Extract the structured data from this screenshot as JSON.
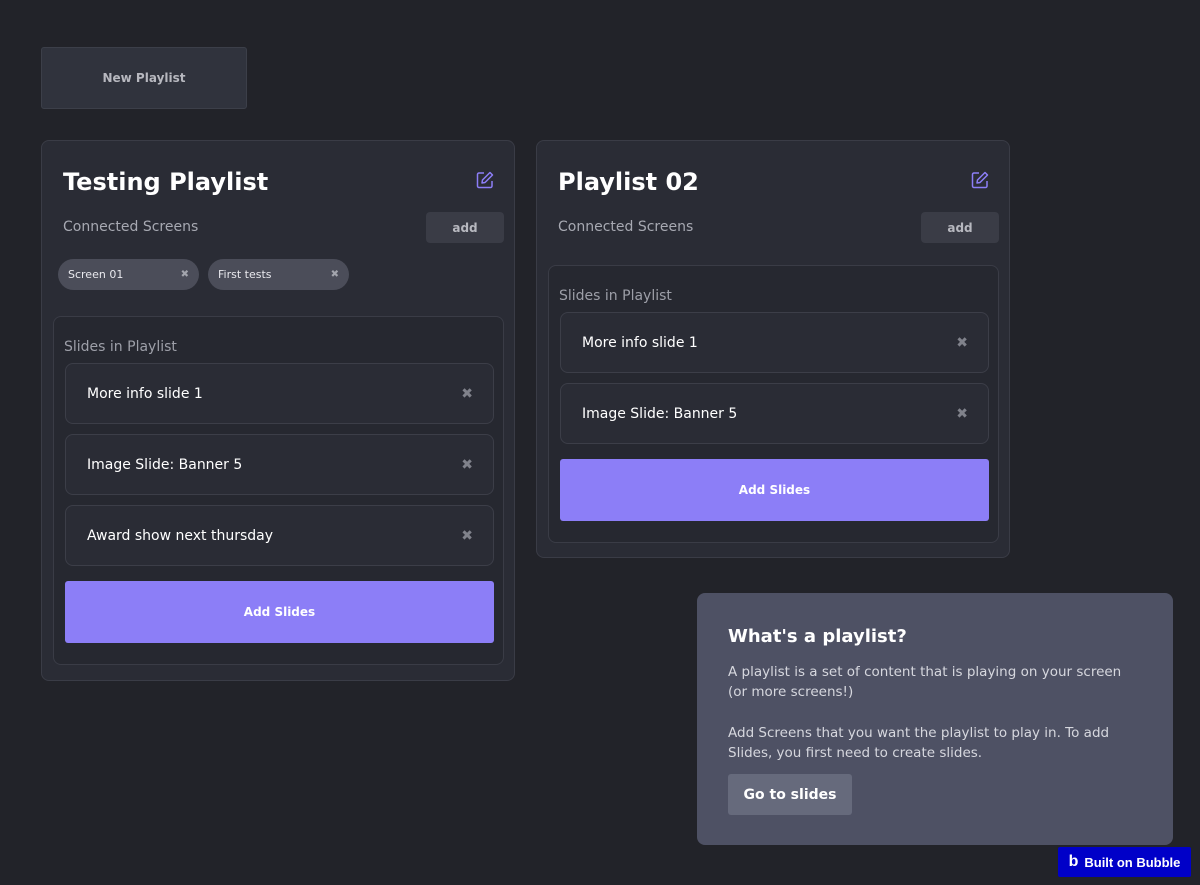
{
  "toolbar": {
    "new_playlist_label": "New Playlist"
  },
  "playlists": [
    {
      "title": "Testing Playlist",
      "connected_label": "Connected Screens",
      "add_label": "add",
      "screens": [
        {
          "name": "Screen 01",
          "remove": "✖"
        },
        {
          "name": "First tests",
          "remove": "✖"
        }
      ],
      "slides_label": "Slides in Playlist",
      "slides": [
        {
          "name": "More info slide 1",
          "remove": "✖"
        },
        {
          "name": "Image Slide: Banner 5",
          "remove": "✖"
        },
        {
          "name": "Award show next thursday",
          "remove": "✖"
        }
      ],
      "add_slides_label": "Add Slides"
    },
    {
      "title": "Playlist 02",
      "connected_label": "Connected Screens",
      "add_label": "add",
      "screens": [],
      "slides_label": "Slides in Playlist",
      "slides": [
        {
          "name": "More info slide 1",
          "remove": "✖"
        },
        {
          "name": "Image Slide: Banner 5",
          "remove": "✖"
        }
      ],
      "add_slides_label": "Add Slides"
    }
  ],
  "info": {
    "title": "What's a playlist?",
    "paragraph1": "A playlist is a set of content that is playing on your screen (or more screens!)",
    "paragraph2": "Add Screens that you want the playlist to play in. To add Slides, you first need to create slides.",
    "button_label": "Go to slides"
  },
  "badge": {
    "logo": "b",
    "label": "Built on Bubble"
  },
  "colors": {
    "background": "#222329",
    "card": "#2a2c35",
    "accent": "#8c7ef7",
    "edit_icon": "#8c7ef7",
    "badge": "#0000c8"
  },
  "icons": {
    "edit": "edit-icon",
    "remove": "close-icon"
  }
}
